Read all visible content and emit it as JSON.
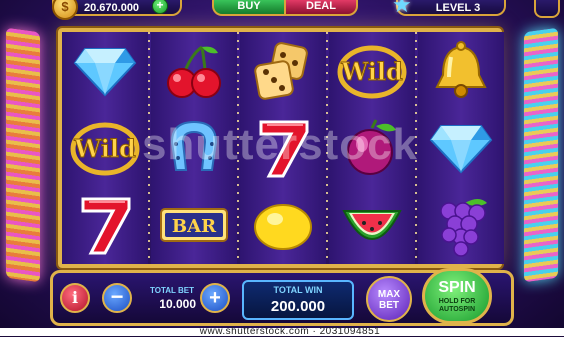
{
  "top_bar": {
    "coin_icon_glyph": "$",
    "coins": "20.670.000",
    "add_coins_label": "+",
    "buy_label": "BUY",
    "deal_label": "DEAL",
    "level_label": "LEVEL 3"
  },
  "reels": [
    [
      "diamond",
      "wild",
      "seven"
    ],
    [
      "cherry",
      "horseshoe",
      "bar"
    ],
    [
      "dice",
      "seven",
      "lemon"
    ],
    [
      "wild",
      "plum",
      "watermelon"
    ],
    [
      "bell",
      "diamond",
      "grapes"
    ]
  ],
  "symbol_text": {
    "wild": "Wild",
    "bar": "BAR",
    "seven": "7"
  },
  "controls": {
    "info_label": "i",
    "minus_label": "−",
    "plus_label": "+",
    "total_bet_label": "TOTAL BET",
    "total_bet_value": "10.000",
    "total_win_label": "TOTAL WIN",
    "total_win_value": "200.000",
    "max_bet_label": "MAX BET",
    "spin_label": "SPIN",
    "spin_sublabel": "HOLD FOR AUTOSPIN"
  },
  "watermark": "shutterstock",
  "footer_text": "www.shutterstock.com · 2031094851",
  "colors": {
    "frame_gold": "#e0b34a",
    "buy_green": "#39c45a",
    "deal_red": "#e23a66",
    "spin_green": "#169a2c"
  }
}
